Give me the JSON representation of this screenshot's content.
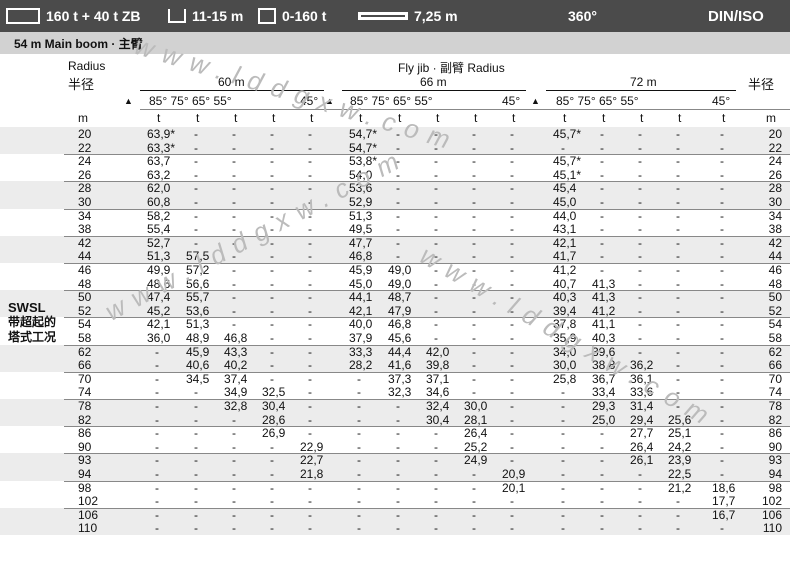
{
  "topbar": {
    "capacity": "160 t + 40 t ZB",
    "item2": "11-15 m",
    "item3": "0-160 t",
    "item4": "7,25 m",
    "rotation": "360°",
    "standard": "DIN/ISO"
  },
  "subbar": {
    "text": "54 m  Main boom · 主臂"
  },
  "header": {
    "radius_en": "Radius",
    "radius_cn": "半径",
    "radius_cn_right": "半径",
    "flyjib": "Fly jib · 副臂 Radius",
    "groups": [
      "60 m",
      "66 m",
      "72 m"
    ],
    "angles": "85° 75° 65° 55°",
    "angle45": "45°",
    "unit_m": "m",
    "unit_t": "t"
  },
  "side_label": {
    "line1": "SWSL",
    "line2": "带超起的",
    "line3": "塔式工况"
  },
  "watermark": {
    "text": "www.lddgxw.com"
  },
  "table": {
    "radii": [
      "20",
      "22",
      "24",
      "26",
      "28",
      "30",
      "34",
      "38",
      "42",
      "44",
      "46",
      "48",
      "50",
      "52",
      "54",
      "58",
      "62",
      "66",
      "70",
      "74",
      "78",
      "82",
      "86",
      "90",
      "93",
      "94",
      "98",
      "102",
      "106",
      "110"
    ],
    "rows": [
      [
        "63,9*",
        "-",
        "-",
        "-",
        "-",
        "54,7*",
        "-",
        "-",
        "-",
        "-",
        "45,7*",
        "-",
        "-",
        "-",
        "-"
      ],
      [
        "63,3*",
        "-",
        "-",
        "-",
        "-",
        "54,7*",
        "-",
        "-",
        "-",
        "-",
        "-",
        "-",
        "-",
        "-",
        "-"
      ],
      [
        "63,7",
        "-",
        "-",
        "-",
        "-",
        "53,8*",
        "-",
        "-",
        "-",
        "-",
        "45,7*",
        "-",
        "-",
        "-",
        "-"
      ],
      [
        "63,2",
        "-",
        "-",
        "-",
        "-",
        "54,0",
        "-",
        "-",
        "-",
        "-",
        "45,1*",
        "-",
        "-",
        "-",
        "-"
      ],
      [
        "62,0",
        "-",
        "-",
        "-",
        "-",
        "53,6",
        "-",
        "-",
        "-",
        "-",
        "45,4",
        "-",
        "-",
        "-",
        "-"
      ],
      [
        "60,8",
        "-",
        "-",
        "-",
        "-",
        "52,9",
        "-",
        "-",
        "-",
        "-",
        "45,0",
        "-",
        "-",
        "-",
        "-"
      ],
      [
        "58,2",
        "-",
        "-",
        "-",
        "-",
        "51,3",
        "-",
        "-",
        "-",
        "-",
        "44,0",
        "-",
        "-",
        "-",
        "-"
      ],
      [
        "55,4",
        "-",
        "-",
        "-",
        "-",
        "49,5",
        "-",
        "-",
        "-",
        "-",
        "43,1",
        "-",
        "-",
        "-",
        "-"
      ],
      [
        "52,7",
        "-",
        "-",
        "-",
        "-",
        "47,7",
        "-",
        "-",
        "-",
        "-",
        "42,1",
        "-",
        "-",
        "-",
        "-"
      ],
      [
        "51,3",
        "57,5",
        "-",
        "-",
        "-",
        "46,8",
        "-",
        "-",
        "-",
        "-",
        "41,7",
        "-",
        "-",
        "-",
        "-"
      ],
      [
        "49,9",
        "57,2",
        "-",
        "-",
        "-",
        "45,9",
        "49,0",
        "-",
        "-",
        "-",
        "41,2",
        "-",
        "-",
        "-",
        "-"
      ],
      [
        "48,6",
        "56,6",
        "-",
        "-",
        "-",
        "45,0",
        "49,0",
        "-",
        "-",
        "-",
        "40,7",
        "41,3",
        "-",
        "-",
        "-"
      ],
      [
        "47,4",
        "55,7",
        "-",
        "-",
        "-",
        "44,1",
        "48,7",
        "-",
        "-",
        "-",
        "40,3",
        "41,3",
        "-",
        "-",
        "-"
      ],
      [
        "45,2",
        "53,6",
        "-",
        "-",
        "-",
        "42,1",
        "47,9",
        "-",
        "-",
        "-",
        "39,4",
        "41,2",
        "-",
        "-",
        "-"
      ],
      [
        "42,1",
        "51,3",
        "-",
        "-",
        "-",
        "40,0",
        "46,8",
        "-",
        "-",
        "-",
        "37,8",
        "41,1",
        "-",
        "-",
        "-"
      ],
      [
        "36,0",
        "48,9",
        "46,8",
        "-",
        "-",
        "37,9",
        "45,6",
        "-",
        "-",
        "-",
        "35,9",
        "40,3",
        "-",
        "-",
        "-"
      ],
      [
        "-",
        "45,9",
        "43,3",
        "-",
        "-",
        "33,3",
        "44,4",
        "42,0",
        "-",
        "-",
        "34,0",
        "39,6",
        "-",
        "-",
        "-"
      ],
      [
        "-",
        "40,6",
        "40,2",
        "-",
        "-",
        "28,2",
        "41,6",
        "39,8",
        "-",
        "-",
        "30,0",
        "38,8",
        "36,2",
        "-",
        "-"
      ],
      [
        "-",
        "34,5",
        "37,4",
        "-",
        "-",
        "-",
        "37,3",
        "37,1",
        "-",
        "-",
        "25,8",
        "36,7",
        "36,1",
        "-",
        "-"
      ],
      [
        "-",
        "-",
        "34,9",
        "32,5",
        "-",
        "-",
        "32,3",
        "34,6",
        "-",
        "-",
        "-",
        "33,4",
        "33,6",
        "-",
        "-"
      ],
      [
        "-",
        "-",
        "32,8",
        "30,4",
        "-",
        "-",
        "-",
        "32,4",
        "30,0",
        "-",
        "-",
        "29,3",
        "31,4",
        "-",
        "-"
      ],
      [
        "-",
        "-",
        "-",
        "28,6",
        "-",
        "-",
        "-",
        "30,4",
        "28,1",
        "-",
        "-",
        "25,0",
        "29,4",
        "25,6",
        "-"
      ],
      [
        "-",
        "-",
        "-",
        "26,9",
        "-",
        "-",
        "-",
        "-",
        "26,4",
        "-",
        "-",
        "-",
        "27,7",
        "25,1",
        "-"
      ],
      [
        "-",
        "-",
        "-",
        "-",
        "22,9",
        "-",
        "-",
        "-",
        "25,2",
        "-",
        "-",
        "-",
        "26,4",
        "24,2",
        "-"
      ],
      [
        "-",
        "-",
        "-",
        "-",
        "22,7",
        "-",
        "-",
        "-",
        "24,9",
        "-",
        "-",
        "-",
        "26,1",
        "23,9",
        "-"
      ],
      [
        "-",
        "-",
        "-",
        "-",
        "21,8",
        "-",
        "-",
        "-",
        "-",
        "20,9",
        "-",
        "-",
        "-",
        "22,5",
        "-"
      ],
      [
        "-",
        "-",
        "-",
        "-",
        "-",
        "-",
        "-",
        "-",
        "-",
        "20,1",
        "-",
        "-",
        "-",
        "21,2",
        "18,6"
      ],
      [
        "-",
        "-",
        "-",
        "-",
        "-",
        "-",
        "-",
        "-",
        "-",
        "-",
        "-",
        "-",
        "-",
        "-",
        "17,7"
      ],
      [
        "-",
        "-",
        "-",
        "-",
        "-",
        "-",
        "-",
        "-",
        "-",
        "-",
        "-",
        "-",
        "-",
        "-",
        "16,7"
      ],
      [
        "-",
        "-",
        "-",
        "-",
        "-",
        "-",
        "-",
        "-",
        "-",
        "-",
        "-",
        "-",
        "-",
        "-",
        "-"
      ]
    ]
  }
}
